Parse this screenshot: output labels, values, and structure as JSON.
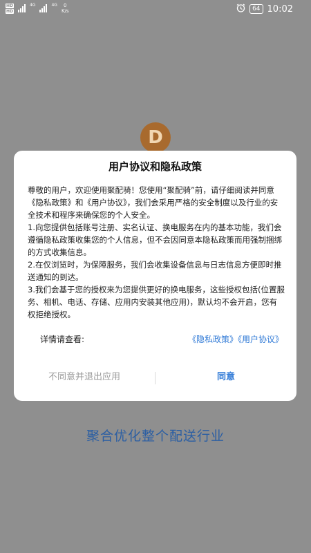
{
  "status_bar": {
    "sim1": "HD",
    "sim2": "HD",
    "net1": "4G",
    "net2": "4G",
    "speed_value": "0",
    "speed_unit": "K/s",
    "battery": "64",
    "time": "10:02",
    "icons": [
      "alarm-icon",
      "battery-icon"
    ]
  },
  "splash": {
    "logo_letter": "D",
    "slogan": "聚合优化整个配送行业"
  },
  "dialog": {
    "title": "用户协议和隐私政策",
    "paragraphs": [
      "尊敬的用户，欢迎使用聚配骑！您使用“聚配骑”前，请仔细阅读并同意《隐私政策》和《用户协议》，我们会采用严格的安全制度以及行业的安全技术和程序来确保您的个人安全。",
      "1.向您提供包括账号注册、实名认证、换电服务在内的基本功能，我们会遵循隐私政策收集您的个人信息，但不会因同意本隐私政策而用强制捆绑的方式收集信息。",
      "2.在仅浏览时，为保障服务，我们会收集设备信息与日志信息方便即时推送通知的到达。",
      "3.我们会基于您的授权来为您提供更好的换电服务，这些授权包括(位置服务、相机、电话、存储、应用内安装其他应用)，默认均不会开启，您有权拒绝授权。"
    ],
    "detail_label": "详情请查看:",
    "privacy_link": "《隐私政策》",
    "user_link": "《用户协议》",
    "disagree_label": "不同意并退出应用",
    "agree_label": "同意"
  },
  "colors": {
    "overlay": "#8f8f8f",
    "link": "#2d78d6",
    "slogan": "#2c5fa3",
    "logo": "#a86a2e"
  }
}
